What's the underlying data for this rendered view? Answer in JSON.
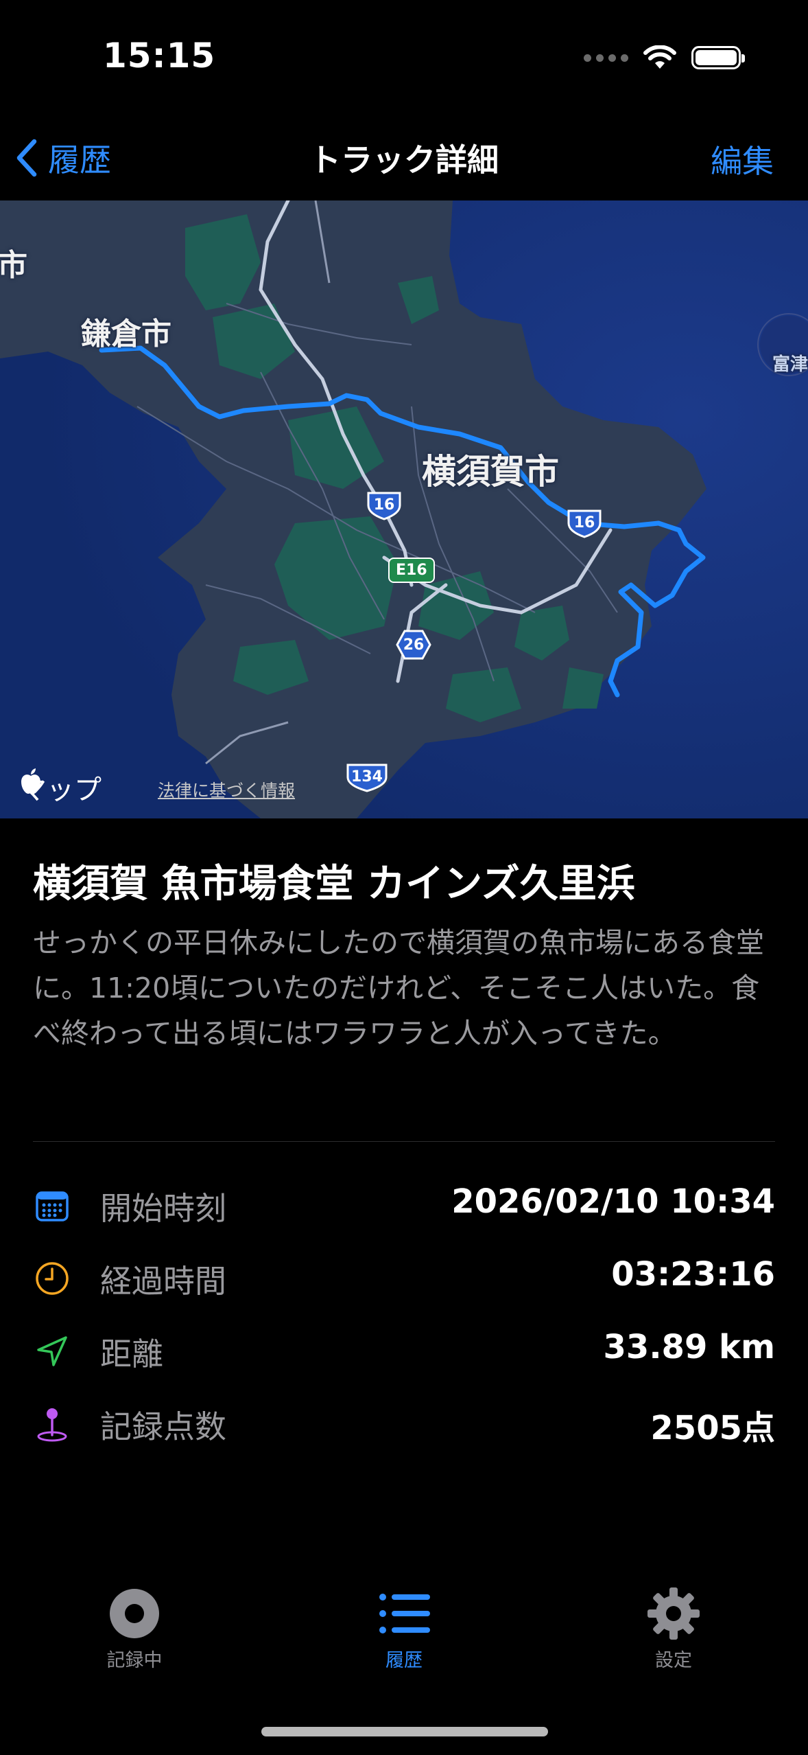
{
  "status_bar": {
    "time": "15:15"
  },
  "nav": {
    "back_label": "履歴",
    "title": "トラック詳細",
    "edit_label": "編集"
  },
  "map": {
    "labels": {
      "kamakura": "鎌倉市",
      "yokosuka": "横須賀市",
      "partial_city": "市",
      "futtsu": "富津"
    },
    "route_shields": {
      "r16_a": "16",
      "r16_b": "16",
      "r26": "26",
      "r134": "134",
      "e16": "E16"
    },
    "brand": "マップ",
    "legal_link": "法律に基づく情報",
    "colors": {
      "water": "#16307a",
      "land": "#2f3d55",
      "park": "#1f5e56",
      "track": "#1e88ff"
    }
  },
  "track": {
    "title": "横須賀 魚市場食堂 カインズ久里浜",
    "description": "せっかくの平日休みにしたので横須賀の魚市場にある食堂に。11:20頃についたのだけれど、そこそこ人はいた。食べ終わって出る頃にはワラワラと人が入ってきた。"
  },
  "stats": {
    "start": {
      "label": "開始時刻",
      "value": "2026/02/10 10:34",
      "icon": "calendar-icon",
      "color": "#2f8cff"
    },
    "elapsed": {
      "label": "経過時間",
      "value": "03:23:16",
      "icon": "clock-icon",
      "color": "#f5a623"
    },
    "distance": {
      "label": "距離",
      "value": "33.89 km",
      "icon": "location-arrow-icon",
      "color": "#34c759"
    },
    "points": {
      "label": "記録点数",
      "value": "2505点",
      "icon": "pin-icon",
      "color": "#bf5af2"
    }
  },
  "tabs": [
    {
      "label": "記録中",
      "icon": "record-icon",
      "active": false
    },
    {
      "label": "履歴",
      "icon": "list-icon",
      "active": true
    },
    {
      "label": "設定",
      "icon": "gear-icon",
      "active": false
    }
  ]
}
